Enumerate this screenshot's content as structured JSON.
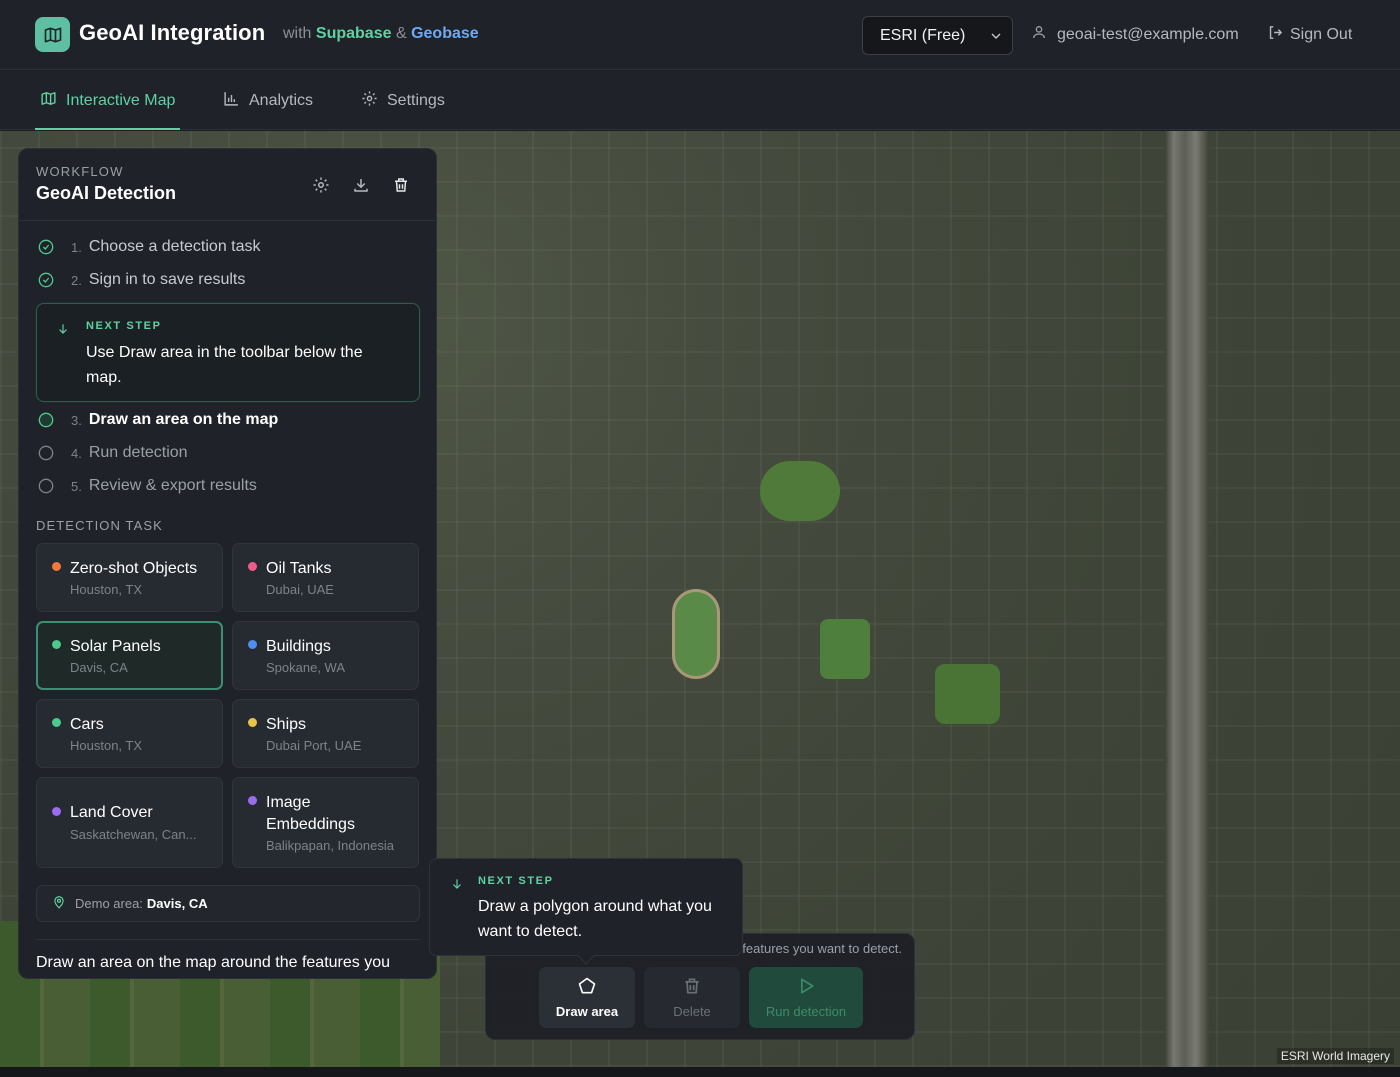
{
  "header": {
    "app_title": "GeoAI Integration",
    "subtitle_with": "with",
    "subtitle_supabase": "Supabase",
    "subtitle_amp": "&",
    "subtitle_geobase": "Geobase",
    "basemap_selected": "ESRI (Free)",
    "user_email": "geoai-test@example.com",
    "sign_out": "Sign Out"
  },
  "tabs": [
    {
      "label": "Interactive Map",
      "active": true
    },
    {
      "label": "Analytics",
      "active": false
    },
    {
      "label": "Settings",
      "active": false
    }
  ],
  "panel": {
    "eyebrow": "WORKFLOW",
    "title": "GeoAI Detection",
    "steps": [
      {
        "num": "1.",
        "label": "Choose a detection task",
        "state": "done"
      },
      {
        "num": "2.",
        "label": "Sign in to save results",
        "state": "done"
      },
      {
        "num": "3.",
        "label": "Draw an area on the map",
        "state": "current"
      },
      {
        "num": "4.",
        "label": "Run detection",
        "state": "todo"
      },
      {
        "num": "5.",
        "label": "Review & export results",
        "state": "todo"
      }
    ],
    "next_step": {
      "label": "NEXT STEP",
      "text": "Use Draw area in the toolbar below the map."
    },
    "section_label": "DETECTION TASK",
    "tasks": [
      {
        "name": "Zero-shot Objects",
        "location": "Houston, TX",
        "color": "#f07a3a"
      },
      {
        "name": "Oil Tanks",
        "location": "Dubai, UAE",
        "color": "#ec5b8a"
      },
      {
        "name": "Solar Panels",
        "location": "Davis, CA",
        "color": "#4ec98e",
        "selected": true
      },
      {
        "name": "Buildings",
        "location": "Spokane, WA",
        "color": "#4d8ef0"
      },
      {
        "name": "Cars",
        "location": "Houston, TX",
        "color": "#4ec98e"
      },
      {
        "name": "Ships",
        "location": "Dubai Port, UAE",
        "color": "#e8c24a"
      },
      {
        "name": "Land Cover",
        "location": "Saskatchewan, Can...",
        "color": "#9b6cf0"
      },
      {
        "name": "Image Embeddings",
        "location": "Balikpapan, Indonesia",
        "color": "#9b6cf0"
      }
    ],
    "demo_area_label": "Demo area:",
    "demo_area_value": "Davis, CA",
    "footer_text": "Draw an area on the map around the features you"
  },
  "map": {
    "attribution": "ESRI World Imagery",
    "tooltip": {
      "label": "NEXT STEP",
      "text": "Draw a polygon around what you want to detect."
    },
    "toolbar": {
      "hint": "Draw an area on the map around the features you want to detect.",
      "draw": "Draw area",
      "delete": "Delete",
      "run": "Run detection"
    }
  },
  "colors": {
    "accent": "#5fd1a2",
    "supabase": "#5fd1a2",
    "geobase": "#6ea9f5"
  }
}
